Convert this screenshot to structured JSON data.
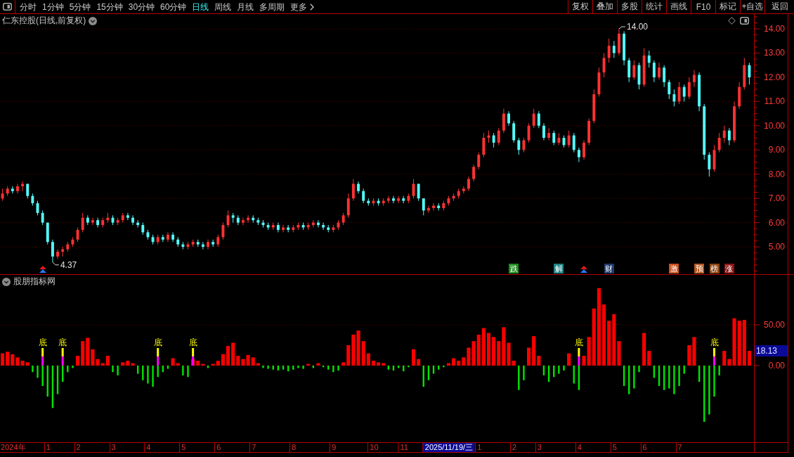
{
  "toolbar": {
    "periods": [
      {
        "label": "分时",
        "selected": false
      },
      {
        "label": "1分钟",
        "selected": false
      },
      {
        "label": "5分钟",
        "selected": false
      },
      {
        "label": "15分钟",
        "selected": false
      },
      {
        "label": "30分钟",
        "selected": false
      },
      {
        "label": "60分钟",
        "selected": false
      },
      {
        "label": "日线",
        "selected": true
      },
      {
        "label": "周线",
        "selected": false
      },
      {
        "label": "月线",
        "selected": false
      },
      {
        "label": "多周期",
        "selected": false
      }
    ],
    "more": "更多",
    "buttons": [
      "复权",
      "叠加",
      "多股",
      "统计",
      "画线",
      "F10",
      "标记",
      "+自选",
      "返回"
    ]
  },
  "price_pane": {
    "title": "仁东控股(日线,前复权)",
    "chart_data": [
      {
        "type": "candlestick",
        "ylim": [
          3.87,
          14.61
        ],
        "yticks": [
          {
            "value": 5,
            "label": "5.00"
          },
          {
            "value": 6,
            "label": "6.00"
          },
          {
            "value": 7,
            "label": "7.00"
          },
          {
            "value": 8,
            "label": "8.00"
          },
          {
            "value": 9,
            "label": "9.00"
          },
          {
            "value": 10,
            "label": "10.00"
          },
          {
            "value": 11,
            "label": "11.00"
          },
          {
            "value": 12,
            "label": "12.00"
          },
          {
            "value": 13,
            "label": "13.00"
          },
          {
            "value": 14,
            "label": "14.00"
          }
        ],
        "tick_labels": "y",
        "grid": true,
        "ohlc": [
          [
            7.0,
            7.4,
            6.9,
            7.2
          ],
          [
            7.2,
            7.5,
            7.1,
            7.4
          ],
          [
            7.4,
            7.5,
            7.2,
            7.3
          ],
          [
            7.3,
            7.6,
            7.2,
            7.5
          ],
          [
            7.5,
            7.7,
            7.3,
            7.6
          ],
          [
            7.6,
            7.6,
            7.0,
            7.1
          ],
          [
            7.1,
            7.2,
            6.7,
            6.8
          ],
          [
            6.8,
            6.9,
            6.3,
            6.4
          ],
          [
            6.4,
            6.5,
            5.9,
            6.0
          ],
          [
            6.0,
            6.0,
            5.1,
            5.2
          ],
          [
            5.2,
            5.3,
            4.37,
            4.6
          ],
          [
            4.6,
            4.9,
            4.5,
            4.8
          ],
          [
            4.8,
            5.0,
            4.6,
            4.9
          ],
          [
            4.9,
            5.2,
            4.8,
            5.1
          ],
          [
            5.1,
            5.4,
            5.0,
            5.3
          ],
          [
            5.3,
            5.8,
            5.2,
            5.7
          ],
          [
            5.7,
            6.4,
            5.6,
            6.2
          ],
          [
            6.2,
            6.3,
            5.9,
            6.0
          ],
          [
            6.0,
            6.2,
            5.9,
            6.1
          ],
          [
            6.1,
            6.2,
            5.8,
            5.9
          ],
          [
            5.9,
            6.2,
            5.8,
            6.1
          ],
          [
            6.1,
            6.4,
            6.0,
            6.2
          ],
          [
            6.2,
            6.3,
            5.9,
            6.0
          ],
          [
            6.0,
            6.2,
            5.9,
            6.1
          ],
          [
            6.1,
            6.4,
            6.0,
            6.3
          ],
          [
            6.3,
            6.4,
            6.1,
            6.2
          ],
          [
            6.2,
            6.3,
            5.9,
            6.0
          ],
          [
            6.0,
            6.1,
            5.8,
            5.9
          ],
          [
            5.9,
            6.0,
            5.5,
            5.6
          ],
          [
            5.6,
            5.7,
            5.3,
            5.4
          ],
          [
            5.4,
            5.5,
            5.1,
            5.2
          ],
          [
            5.2,
            5.5,
            5.1,
            5.4
          ],
          [
            5.4,
            5.5,
            5.2,
            5.3
          ],
          [
            5.3,
            5.6,
            5.2,
            5.5
          ],
          [
            5.5,
            5.6,
            5.2,
            5.3
          ],
          [
            5.3,
            5.4,
            5.0,
            5.1
          ],
          [
            5.1,
            5.2,
            4.9,
            5.0
          ],
          [
            5.0,
            5.2,
            4.9,
            5.1
          ],
          [
            5.1,
            5.3,
            5.0,
            5.2
          ],
          [
            5.2,
            5.3,
            5.0,
            5.1
          ],
          [
            5.1,
            5.2,
            4.9,
            5.0
          ],
          [
            5.0,
            5.3,
            4.9,
            5.2
          ],
          [
            5.2,
            5.3,
            5.0,
            5.1
          ],
          [
            5.1,
            5.5,
            5.0,
            5.4
          ],
          [
            5.4,
            6.0,
            5.3,
            5.9
          ],
          [
            5.9,
            6.5,
            5.8,
            6.3
          ],
          [
            6.3,
            6.4,
            6.0,
            6.2
          ],
          [
            6.2,
            6.3,
            5.9,
            6.0
          ],
          [
            6.0,
            6.2,
            5.9,
            6.1
          ],
          [
            6.1,
            6.3,
            6.0,
            6.2
          ],
          [
            6.2,
            6.3,
            6.0,
            6.1
          ],
          [
            6.1,
            6.2,
            5.9,
            6.0
          ],
          [
            6.0,
            6.1,
            5.8,
            5.9
          ],
          [
            5.9,
            6.0,
            5.7,
            5.8
          ],
          [
            5.8,
            6.0,
            5.7,
            5.9
          ],
          [
            5.9,
            6.0,
            5.6,
            5.7
          ],
          [
            5.7,
            5.9,
            5.6,
            5.8
          ],
          [
            5.8,
            5.9,
            5.6,
            5.7
          ],
          [
            5.7,
            5.9,
            5.6,
            5.8
          ],
          [
            5.8,
            6.0,
            5.7,
            5.9
          ],
          [
            5.9,
            6.0,
            5.7,
            5.8
          ],
          [
            5.8,
            6.0,
            5.7,
            5.9
          ],
          [
            5.9,
            6.1,
            5.8,
            6.0
          ],
          [
            6.0,
            6.1,
            5.8,
            5.9
          ],
          [
            5.9,
            6.0,
            5.7,
            5.8
          ],
          [
            5.8,
            5.9,
            5.6,
            5.7
          ],
          [
            5.7,
            5.9,
            5.6,
            5.8
          ],
          [
            5.8,
            6.1,
            5.7,
            6.0
          ],
          [
            6.0,
            6.4,
            5.9,
            6.3
          ],
          [
            6.3,
            7.2,
            6.2,
            7.0
          ],
          [
            7.0,
            7.8,
            6.9,
            7.6
          ],
          [
            7.6,
            7.7,
            7.2,
            7.3
          ],
          [
            7.3,
            7.4,
            6.8,
            6.9
          ],
          [
            6.9,
            7.0,
            6.7,
            6.8
          ],
          [
            6.8,
            7.0,
            6.7,
            6.9
          ],
          [
            6.9,
            7.0,
            6.7,
            6.8
          ],
          [
            6.8,
            7.0,
            6.7,
            6.9
          ],
          [
            6.9,
            7.1,
            6.8,
            7.0
          ],
          [
            7.0,
            7.1,
            6.8,
            6.9
          ],
          [
            6.9,
            7.1,
            6.8,
            7.0
          ],
          [
            7.0,
            7.1,
            6.8,
            6.9
          ],
          [
            6.9,
            7.2,
            6.8,
            7.1
          ],
          [
            7.1,
            7.8,
            7.0,
            7.6
          ],
          [
            7.6,
            7.6,
            6.9,
            7.0
          ],
          [
            7.0,
            7.0,
            6.3,
            6.5
          ],
          [
            6.5,
            6.7,
            6.4,
            6.6
          ],
          [
            6.6,
            6.8,
            6.5,
            6.7
          ],
          [
            6.7,
            6.8,
            6.5,
            6.6
          ],
          [
            6.6,
            6.9,
            6.5,
            6.8
          ],
          [
            6.8,
            7.1,
            6.7,
            7.0
          ],
          [
            7.0,
            7.2,
            6.9,
            7.1
          ],
          [
            7.1,
            7.4,
            7.0,
            7.3
          ],
          [
            7.3,
            7.5,
            7.2,
            7.4
          ],
          [
            7.4,
            7.9,
            7.3,
            7.8
          ],
          [
            7.8,
            8.4,
            7.7,
            8.3
          ],
          [
            8.3,
            8.9,
            8.2,
            8.8
          ],
          [
            8.8,
            9.7,
            8.7,
            9.5
          ],
          [
            9.5,
            9.8,
            9.3,
            9.6
          ],
          [
            9.6,
            9.7,
            9.1,
            9.3
          ],
          [
            9.3,
            9.9,
            9.2,
            9.8
          ],
          [
            9.8,
            10.7,
            9.7,
            10.5
          ],
          [
            10.5,
            10.6,
            10.0,
            10.1
          ],
          [
            10.1,
            10.2,
            9.3,
            9.4
          ],
          [
            9.4,
            9.5,
            8.8,
            9.0
          ],
          [
            9.0,
            9.5,
            8.9,
            9.4
          ],
          [
            9.4,
            10.1,
            9.3,
            10.0
          ],
          [
            10.0,
            10.7,
            9.9,
            10.5
          ],
          [
            10.5,
            10.6,
            9.9,
            10.0
          ],
          [
            10.0,
            10.1,
            9.4,
            9.5
          ],
          [
            9.5,
            9.9,
            9.4,
            9.7
          ],
          [
            9.7,
            9.8,
            9.2,
            9.3
          ],
          [
            9.3,
            9.7,
            9.2,
            9.5
          ],
          [
            9.5,
            9.6,
            9.1,
            9.2
          ],
          [
            9.2,
            9.8,
            9.1,
            9.6
          ],
          [
            9.6,
            9.7,
            8.9,
            9.0
          ],
          [
            9.0,
            9.1,
            8.5,
            8.7
          ],
          [
            8.7,
            9.4,
            8.6,
            9.3
          ],
          [
            9.3,
            10.3,
            9.2,
            10.2
          ],
          [
            10.2,
            11.5,
            10.1,
            11.3
          ],
          [
            11.3,
            12.4,
            11.2,
            12.2
          ],
          [
            12.2,
            13.0,
            12.0,
            12.8
          ],
          [
            12.8,
            13.6,
            12.6,
            13.3
          ],
          [
            13.3,
            13.5,
            12.8,
            13.0
          ],
          [
            13.0,
            14.0,
            12.9,
            13.8
          ],
          [
            13.8,
            13.9,
            12.5,
            12.7
          ],
          [
            12.7,
            12.8,
            11.8,
            12.0
          ],
          [
            12.0,
            12.7,
            11.9,
            12.5
          ],
          [
            12.5,
            12.6,
            11.5,
            11.7
          ],
          [
            11.7,
            13.2,
            11.6,
            12.9
          ],
          [
            12.9,
            13.1,
            12.4,
            12.6
          ],
          [
            12.6,
            12.7,
            11.8,
            12.0
          ],
          [
            12.0,
            12.6,
            11.9,
            12.4
          ],
          [
            12.4,
            12.5,
            11.6,
            11.8
          ],
          [
            11.8,
            11.9,
            11.1,
            11.3
          ],
          [
            11.3,
            11.5,
            10.8,
            11.0
          ],
          [
            11.0,
            11.8,
            10.9,
            11.6
          ],
          [
            11.6,
            11.7,
            11.0,
            11.2
          ],
          [
            11.2,
            12.0,
            11.1,
            11.8
          ],
          [
            11.8,
            12.3,
            11.6,
            12.1
          ],
          [
            12.1,
            12.2,
            10.6,
            10.8
          ],
          [
            10.8,
            10.9,
            8.6,
            8.8
          ],
          [
            8.8,
            8.9,
            7.9,
            8.2
          ],
          [
            8.2,
            9.2,
            8.1,
            9.0
          ],
          [
            9.0,
            9.7,
            8.9,
            9.5
          ],
          [
            9.5,
            10.0,
            9.3,
            9.8
          ],
          [
            9.8,
            9.9,
            9.2,
            9.4
          ],
          [
            9.4,
            11.0,
            9.3,
            10.8
          ],
          [
            10.8,
            11.8,
            10.7,
            11.6
          ],
          [
            11.6,
            12.8,
            11.5,
            12.5
          ],
          [
            12.5,
            12.6,
            11.7,
            12.0
          ]
        ],
        "annotations": [
          "14.00",
          "4.37"
        ]
      }
    ],
    "event_tags": [
      {
        "kind": "arrow"
      },
      {
        "kind": "tag",
        "label": "跌",
        "color": "#1e8c1e"
      },
      {
        "kind": "tag",
        "label": "解",
        "color": "#1e8282"
      },
      {
        "kind": "arrow"
      },
      {
        "kind": "tag",
        "label": "财",
        "color": "#1e3c6e"
      },
      {
        "kind": "tag",
        "label": "激",
        "color": "#c8501e"
      },
      {
        "kind": "tag",
        "label": "预",
        "color": "#b4561e"
      },
      {
        "kind": "tag",
        "label": "榜",
        "color": "#8c4614"
      },
      {
        "kind": "tag",
        "label": "涨",
        "color": "#8c1414"
      }
    ]
  },
  "indicator_pane": {
    "title": "股朋指标网",
    "chart_data": [
      {
        "type": "bar",
        "ylim": [
          -94,
          111.2
        ],
        "yticks": [
          {
            "value": 0,
            "label": "0.00"
          },
          {
            "value": 50,
            "label": "50.00"
          }
        ],
        "grid": true,
        "categories": [
          null,
          null,
          "2024年",
          null,
          null,
          null,
          null,
          null,
          null,
          "1",
          null,
          null,
          null,
          null,
          null,
          "2",
          null,
          null,
          null,
          null,
          null,
          null,
          "3",
          null,
          null,
          null,
          null,
          null,
          null,
          "4",
          null,
          null,
          null,
          null,
          null,
          null,
          "5",
          null,
          null,
          null,
          null,
          null,
          null,
          "6",
          null,
          null,
          null,
          null,
          null,
          null,
          "7",
          null,
          null,
          null,
          null,
          null,
          null,
          null,
          "8",
          null,
          null,
          null,
          null,
          null,
          null,
          null,
          "9",
          null,
          null,
          null,
          null,
          null,
          null,
          null,
          "10",
          null,
          null,
          null,
          null,
          null,
          "11",
          null,
          null,
          null,
          null,
          null,
          null,
          null,
          null,
          null,
          null,
          null,
          null,
          null,
          null,
          "1",
          null,
          null,
          null,
          null,
          null,
          null,
          "2",
          null,
          null,
          null,
          null,
          "3",
          null,
          null,
          null,
          null,
          null,
          null,
          null,
          "4",
          null,
          null,
          null,
          null,
          null,
          null,
          "5",
          null,
          null,
          null,
          null,
          null,
          "6",
          null,
          null,
          null,
          null,
          null,
          null,
          "7",
          null,
          null,
          null,
          null,
          null,
          null,
          null,
          null,
          null,
          null,
          null,
          null,
          null,
          null
        ],
        "values": [
          15,
          17,
          14,
          10,
          6,
          4,
          -8,
          -15,
          -25,
          -38,
          -52,
          -35,
          -20,
          -8,
          -3,
          12,
          30,
          34,
          20,
          8,
          3,
          12,
          -8,
          -12,
          4,
          6,
          3,
          -10,
          -18,
          -22,
          -26,
          -14,
          -8,
          -4,
          9,
          3,
          -12,
          -14,
          8,
          6,
          2,
          -3,
          2,
          6,
          14,
          24,
          28,
          12,
          8,
          13,
          10,
          3,
          -3,
          -4,
          -5,
          -6,
          -5,
          -7,
          -5,
          -3,
          -4,
          2,
          -3,
          3,
          -2,
          -5,
          -8,
          -6,
          4,
          25,
          38,
          43,
          30,
          15,
          6,
          4,
          3,
          -5,
          -6,
          -3,
          -7,
          -2,
          20,
          8,
          -26,
          -18,
          -10,
          -5,
          -2,
          3,
          9,
          6,
          10,
          22,
          30,
          38,
          46,
          40,
          35,
          30,
          47,
          28,
          6,
          -30,
          -18,
          22,
          36,
          12,
          -12,
          -20,
          -14,
          -10,
          -6,
          15,
          -22,
          -30,
          12,
          35,
          70,
          95,
          75,
          55,
          63,
          30,
          -25,
          -35,
          -28,
          -8,
          40,
          18,
          -15,
          -25,
          -30,
          -28,
          -35,
          -25,
          -10,
          25,
          35,
          -20,
          -69,
          -60,
          -38,
          -12,
          18,
          8,
          58,
          55,
          56,
          18
        ],
        "value_labels": [
          null,
          null,
          null,
          null,
          null,
          null,
          null,
          null,
          "底",
          null,
          null,
          null,
          "底",
          null,
          null,
          null,
          null,
          null,
          null,
          null,
          null,
          null,
          null,
          null,
          null,
          null,
          null,
          null,
          null,
          null,
          null,
          "底",
          null,
          null,
          null,
          null,
          null,
          null,
          "底",
          null,
          null,
          null,
          null,
          null,
          null,
          null,
          null,
          null,
          null,
          null,
          null,
          null,
          null,
          null,
          null,
          null,
          null,
          null,
          null,
          null,
          null,
          null,
          null,
          null,
          null,
          null,
          null,
          null,
          null,
          null,
          null,
          null,
          null,
          null,
          null,
          null,
          null,
          null,
          null,
          null,
          null,
          null,
          null,
          null,
          null,
          null,
          null,
          null,
          null,
          null,
          null,
          null,
          null,
          null,
          null,
          null,
          null,
          null,
          null,
          null,
          null,
          null,
          null,
          null,
          null,
          null,
          null,
          null,
          null,
          null,
          null,
          null,
          null,
          null,
          null,
          "底",
          null,
          null,
          null,
          null,
          null,
          null,
          null,
          null,
          null,
          null,
          null,
          null,
          null,
          null,
          null,
          null,
          null,
          null,
          null,
          null,
          null,
          null,
          null,
          null,
          null,
          null,
          "底",
          null,
          null,
          null,
          null,
          null,
          null,
          null
        ],
        "annotations": [
          "18.13"
        ]
      }
    ],
    "cursor_date": "2025/11/19/三"
  }
}
